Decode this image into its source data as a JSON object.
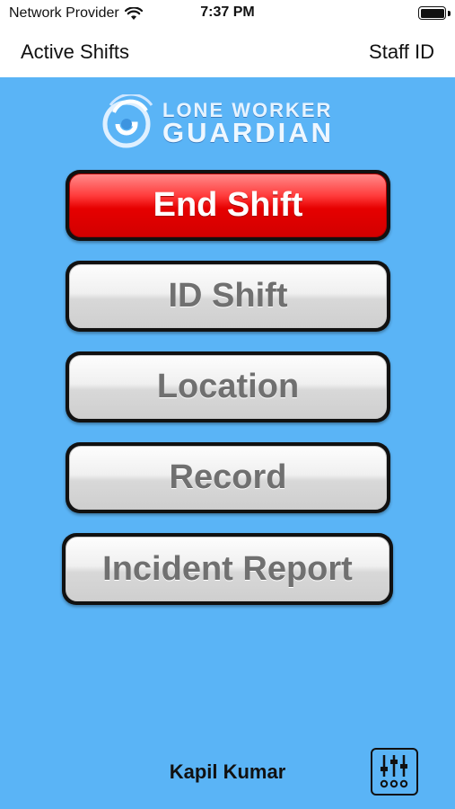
{
  "status_bar": {
    "carrier": "Network Provider",
    "time": "7:37 PM",
    "icons": [
      "wifi-icon",
      "battery-icon"
    ]
  },
  "nav": {
    "left_label": "Active Shifts",
    "right_label": "Staff ID"
  },
  "logo": {
    "line1": "LONE WORKER",
    "line2": "GUARDIAN"
  },
  "buttons": {
    "end_shift": "End Shift",
    "id_shift": "ID Shift",
    "location": "Location",
    "record": "Record",
    "incident_report": "Incident Report"
  },
  "footer": {
    "user_name": "Kapil Kumar",
    "settings_icon": "sliders-icon"
  },
  "colors": {
    "background": "#5ab4f6",
    "end_shift": "#e60000",
    "button_grey": "#e6e6e6",
    "button_text_grey": "#707070"
  }
}
